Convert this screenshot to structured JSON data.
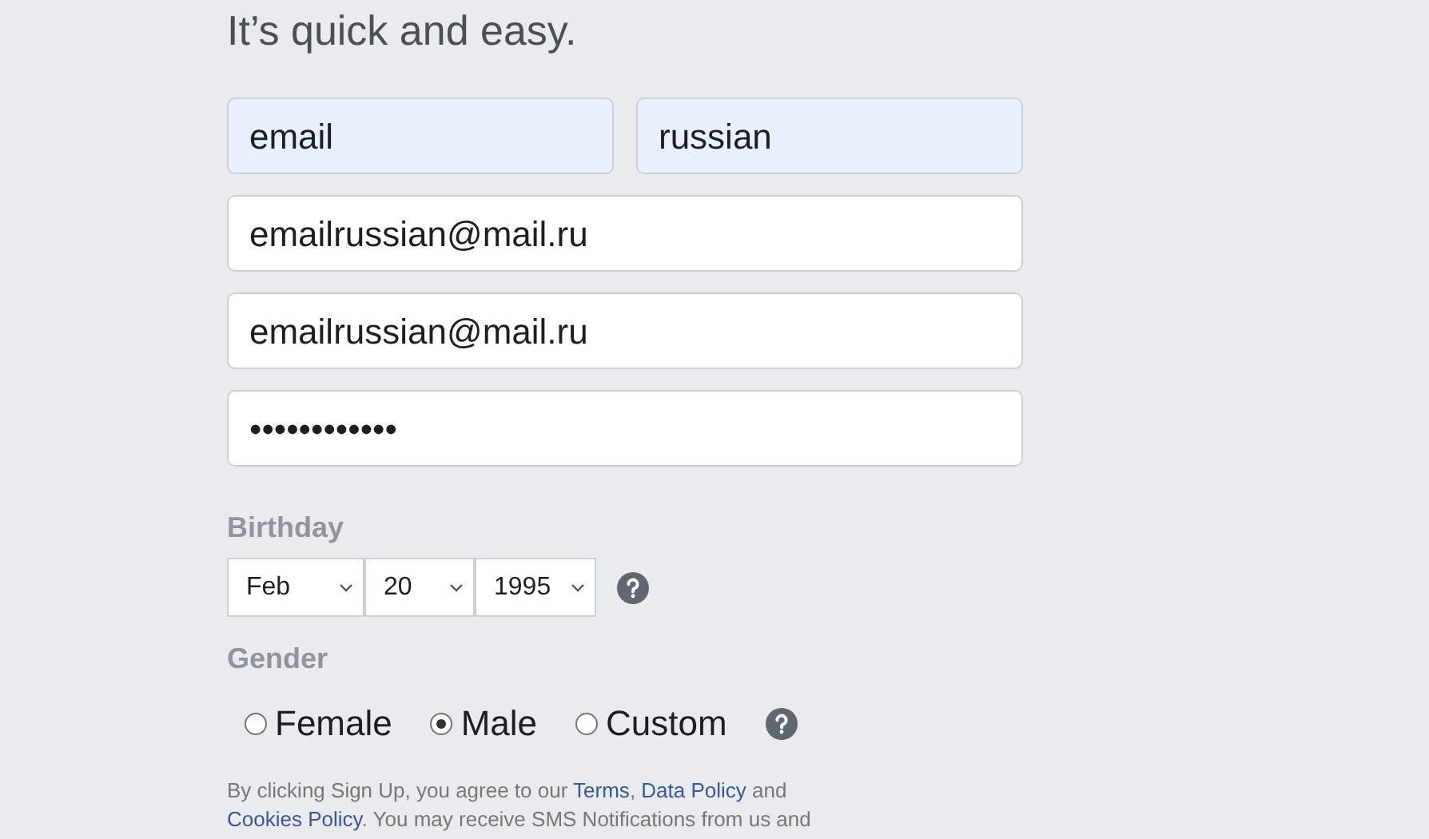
{
  "subtitle": "It’s quick and easy.",
  "first_name": {
    "value": "email"
  },
  "last_name": {
    "value": "russian"
  },
  "email": {
    "value": "emailrussian@mail.ru"
  },
  "email_confirm": {
    "value": "emailrussian@mail.ru"
  },
  "password": {
    "value": "••••••••••••"
  },
  "birthday": {
    "label": "Birthday",
    "selects": [
      {
        "value": "Feb"
      },
      {
        "value": "20"
      },
      {
        "value": "1995"
      }
    ]
  },
  "gender": {
    "label": "Gender",
    "options": [
      {
        "label": "Female",
        "selected": false
      },
      {
        "label": "Male",
        "selected": true
      },
      {
        "label": "Custom",
        "selected": false
      }
    ]
  },
  "legal": [
    {
      "kind": "text",
      "text": "By clicking Sign Up, you agree to our "
    },
    {
      "kind": "link",
      "text": "Terms"
    },
    {
      "kind": "text",
      "text": ", "
    },
    {
      "kind": "link",
      "text": "Data Policy"
    },
    {
      "kind": "text",
      "text": " and "
    },
    {
      "kind": "link",
      "text": "Cookies Policy"
    },
    {
      "kind": "text",
      "text": ". You may receive SMS Notifications from us and"
    }
  ]
}
